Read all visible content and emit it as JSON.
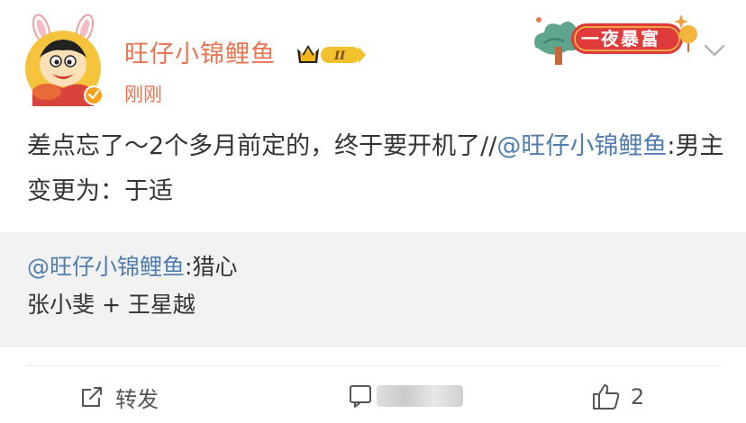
{
  "post": {
    "username": "旺仔小锦鲤鱼",
    "timestamp": "刚刚",
    "crown_level": "II",
    "decor_badge_text": "一夜暴富",
    "text_before": "差点忘了～2个多月前定的，终于要开机了//",
    "mention": "@旺仔小锦鲤鱼",
    "text_after": ":男主变更为：于适"
  },
  "repost": {
    "mention": "@旺仔小锦鲤鱼",
    "text_after": ":猎心",
    "line2": "张小斐 + 王星越"
  },
  "actions": {
    "repost_label": "转发",
    "like_count": "2"
  },
  "colors": {
    "username": "#eb7350",
    "mention": "#507daf",
    "repost_bg": "#f2f2f2"
  }
}
